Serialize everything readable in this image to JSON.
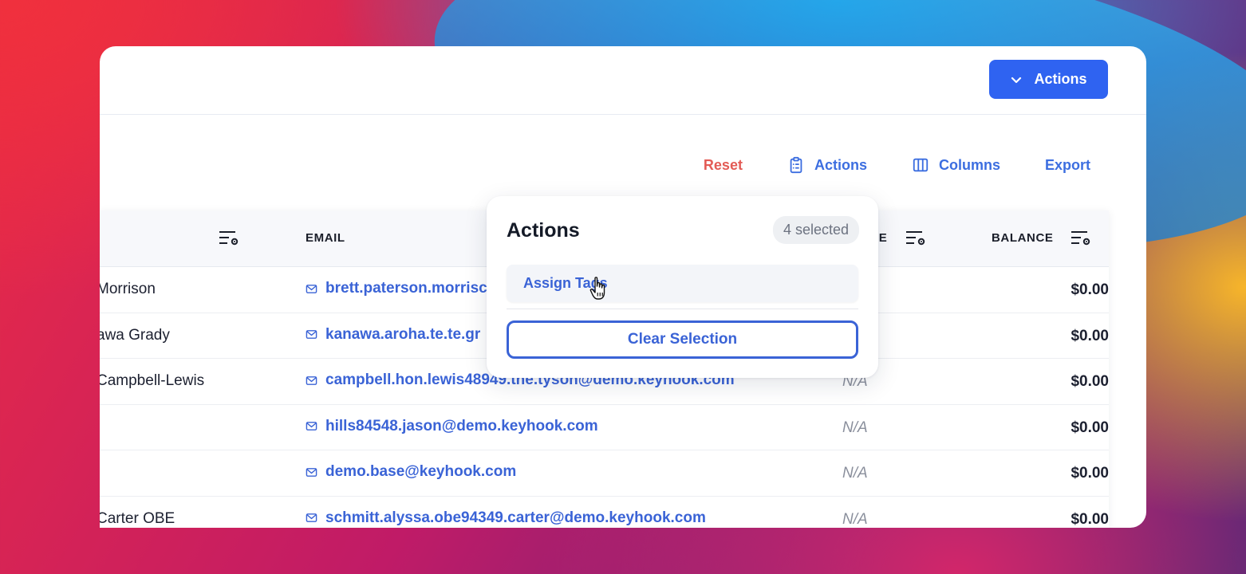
{
  "header": {
    "actions_button_label": "Actions"
  },
  "toolbar": {
    "reset_label": "Reset",
    "actions_label": "Actions",
    "columns_label": "Columns",
    "export_label": "Export"
  },
  "table": {
    "columns": {
      "email": "EMAIL",
      "phone_partial": "IE",
      "balance": "BALANCE"
    },
    "rows": [
      {
        "name": "Morrison",
        "email": "brett.paterson.morrisc",
        "phone": "",
        "balance": "$0.00"
      },
      {
        "name": "awa Grady",
        "email": "kanawa.aroha.te.te.gr",
        "phone": "",
        "balance": "$0.00"
      },
      {
        "name": "Campbell-Lewis",
        "email": "campbell.hon.lewis48949.the.tyson@demo.keyhook.com",
        "phone": "N/A",
        "balance": "$0.00"
      },
      {
        "name": "",
        "email": "hills84548.jason@demo.keyhook.com",
        "phone": "N/A",
        "balance": "$0.00"
      },
      {
        "name": "",
        "email": "demo.base@keyhook.com",
        "phone": "N/A",
        "balance": "$0.00"
      },
      {
        "name": "Carter OBE",
        "email": "schmitt.alyssa.obe94349.carter@demo.keyhook.com",
        "phone": "N/A",
        "balance": "$0.00"
      }
    ]
  },
  "popover": {
    "title": "Actions",
    "selected_badge": "4 selected",
    "item_label": "Assign Tags",
    "clear_label": "Clear Selection"
  },
  "colors": {
    "primary": "#2f63f1",
    "link": "#3a63d6",
    "reset": "#e35b55"
  }
}
